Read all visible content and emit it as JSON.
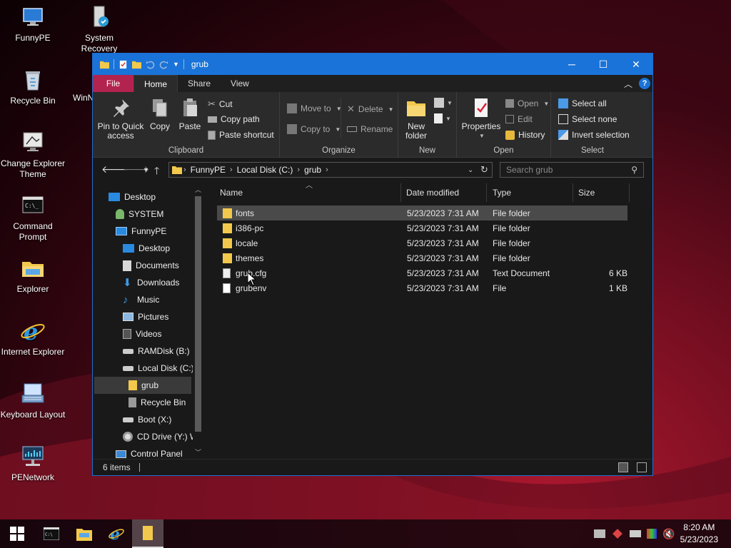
{
  "desktop": {
    "icons": [
      {
        "label": "FunnyPE"
      },
      {
        "label": "System Recovery"
      },
      {
        "label": "Recycle Bin"
      },
      {
        "label": "WinN"
      },
      {
        "label": "Change Explorer Theme"
      },
      {
        "label": "Command Prompt"
      },
      {
        "label": "Explorer"
      },
      {
        "label": "Internet Explorer"
      },
      {
        "label": "Keyboard Layout"
      },
      {
        "label": "PENetwork"
      }
    ]
  },
  "window": {
    "title": "grub",
    "controls": {
      "minimize": "─",
      "maximize": "☐",
      "close": "✕"
    }
  },
  "ribbon": {
    "tabs": [
      {
        "label": "File"
      },
      {
        "label": "Home"
      },
      {
        "label": "Share"
      },
      {
        "label": "View"
      }
    ],
    "clipboard": {
      "label": "Clipboard",
      "pin": "Pin to Quick access",
      "pin_line1": "Pin to Quick",
      "pin_line2": "access",
      "copy": "Copy",
      "paste": "Paste",
      "cut": "Cut",
      "copy_path": "Copy path",
      "paste_shortcut": "Paste shortcut"
    },
    "organize": {
      "label": "Organize",
      "move_to": "Move to",
      "copy_to": "Copy to",
      "delete": "Delete",
      "rename": "Rename"
    },
    "new": {
      "label": "New",
      "new_folder_line1": "New",
      "new_folder_line2": "folder"
    },
    "open": {
      "label": "Open",
      "properties": "Properties",
      "open": "Open",
      "edit": "Edit",
      "history": "History"
    },
    "select": {
      "label": "Select",
      "select_all": "Select all",
      "select_none": "Select none",
      "invert": "Invert selection"
    }
  },
  "address": {
    "breadcrumbs": [
      "FunnyPE",
      "Local Disk (C:)",
      "grub"
    ],
    "search_placeholder": "Search grub"
  },
  "navpane": {
    "items": [
      {
        "label": "Desktop"
      },
      {
        "label": "SYSTEM"
      },
      {
        "label": "FunnyPE"
      },
      {
        "label": "Desktop"
      },
      {
        "label": "Documents"
      },
      {
        "label": "Downloads"
      },
      {
        "label": "Music"
      },
      {
        "label": "Pictures"
      },
      {
        "label": "Videos"
      },
      {
        "label": "RAMDisk (B:)"
      },
      {
        "label": "Local Disk (C:)"
      },
      {
        "label": "grub"
      },
      {
        "label": "Recycle Bin"
      },
      {
        "label": "Boot (X:)"
      },
      {
        "label": "CD Drive (Y:) W"
      },
      {
        "label": "Control Panel"
      }
    ]
  },
  "filelist": {
    "columns": {
      "name": "Name",
      "date": "Date modified",
      "type": "Type",
      "size": "Size"
    },
    "rows": [
      {
        "name": "fonts",
        "date": "5/23/2023 7:31 AM",
        "type": "File folder",
        "size": ""
      },
      {
        "name": "i386-pc",
        "date": "5/23/2023 7:31 AM",
        "type": "File folder",
        "size": ""
      },
      {
        "name": "locale",
        "date": "5/23/2023 7:31 AM",
        "type": "File folder",
        "size": ""
      },
      {
        "name": "themes",
        "date": "5/23/2023 7:31 AM",
        "type": "File folder",
        "size": ""
      },
      {
        "name": "grub.cfg",
        "date": "5/23/2023 7:31 AM",
        "type": "Text Document",
        "size": "6 KB"
      },
      {
        "name": "grubenv",
        "date": "5/23/2023 7:31 AM",
        "type": "File",
        "size": "1 KB"
      }
    ]
  },
  "status": {
    "items": "6 items"
  },
  "taskbar": {
    "time": "8:20 AM",
    "date": "5/23/2023"
  },
  "colors": {
    "titlebar": "#1a73d8",
    "file_tab": "#b3234f",
    "folder": "#f2c94c",
    "window_bg": "#191919",
    "ribbon_bg": "#2b2b2b"
  }
}
